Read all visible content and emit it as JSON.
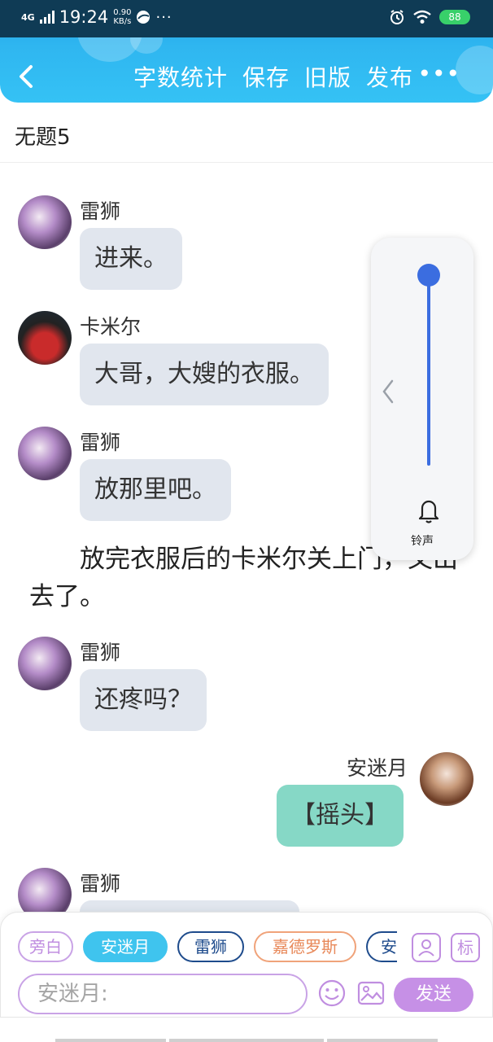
{
  "status_bar": {
    "network": "4G",
    "time": "19:24",
    "speed_value": "0.90",
    "speed_unit": "KB/s",
    "more": "···",
    "battery": "88"
  },
  "header": {
    "actions": [
      "字数统计",
      "保存",
      "旧版",
      "发布"
    ],
    "more": "•••"
  },
  "document": {
    "title": "无题5"
  },
  "messages": [
    {
      "speaker": "雷狮",
      "text": "进来。"
    },
    {
      "speaker": "卡米尔",
      "text": "大哥，大嫂的衣服。"
    },
    {
      "speaker": "雷狮",
      "text": "放那里吧。"
    },
    {
      "narration": "放完衣服后的卡米尔关上门，又出去了。"
    },
    {
      "speaker": "雷狮",
      "text": "还疼吗？"
    },
    {
      "speaker": "安迷月",
      "text": "【摇头】"
    },
    {
      "speaker": "雷狮",
      "text": ""
    }
  ],
  "volume_panel": {
    "label": "铃声",
    "level": 1.0
  },
  "composer": {
    "roles": [
      "旁白",
      "安迷月",
      "雷狮",
      "嘉德罗斯",
      "安"
    ],
    "tag_icon": "标",
    "input_placeholder": "安迷月:",
    "send": "发送"
  },
  "colors": {
    "header_blue": "#35c2f5",
    "bubble_gray": "#e1e6ee",
    "bubble_teal": "#86d8c6",
    "accent_purple": "#c690e6",
    "slider_blue": "#3b6de0"
  }
}
